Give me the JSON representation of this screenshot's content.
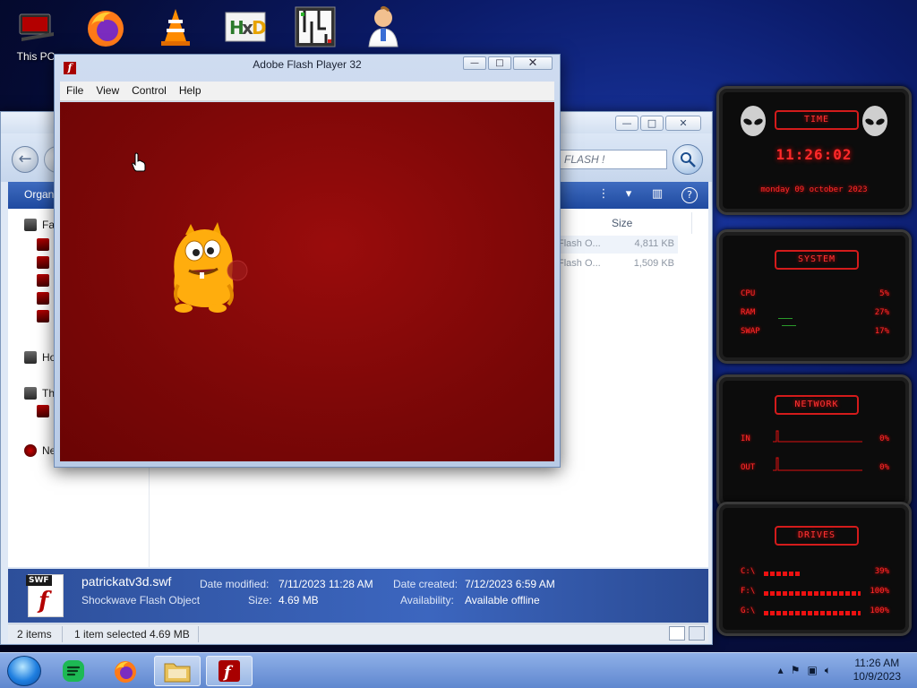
{
  "desktop": {
    "icons": [
      {
        "label": "This PC"
      },
      {
        "label": ""
      },
      {
        "label": ""
      },
      {
        "label": ""
      },
      {
        "label": ""
      },
      {
        "label": ""
      }
    ]
  },
  "flash_window": {
    "title": "Adobe Flash Player 32",
    "menu": [
      "File",
      "View",
      "Control",
      "Help"
    ],
    "buttons": {
      "minimize": "—",
      "maximize": "□",
      "close": "✕"
    }
  },
  "explorer": {
    "toolbar": {
      "organize": "Organi"
    },
    "search_text": "FLASH !",
    "columns": {
      "size": "Size"
    },
    "files": [
      {
        "type": "Flash O...",
        "size": "4,811 KB"
      },
      {
        "type": "Flash O...",
        "size": "1,509 KB"
      }
    ],
    "nav_items": [
      "Fa",
      "Ho",
      "Th",
      "Ne"
    ],
    "details": {
      "filename": "patrickatv3d.swf",
      "filetype": "Shockwave Flash Object",
      "date_modified_label": "Date modified:",
      "date_modified": "7/11/2023 11:28 AM",
      "size_label": "Size:",
      "size": "4.69 MB",
      "date_created_label": "Date created:",
      "date_created": "7/12/2023 6:59 AM",
      "availability_label": "Availability:",
      "availability": "Available offline",
      "icon_tag": "SWF",
      "icon_letter": "f"
    },
    "status": {
      "items": "2 items",
      "selected": "1 item selected  4.69 MB"
    }
  },
  "gadgets": {
    "time": {
      "title": "TIME",
      "clock": "11:26:02",
      "date": "monday 09 october 2023"
    },
    "system": {
      "title": "SYSTEM",
      "rows": [
        {
          "label": "CPU",
          "value": "5%"
        },
        {
          "label": "RAM",
          "value": "27%"
        },
        {
          "label": "SWAP",
          "value": "17%"
        }
      ]
    },
    "network": {
      "title": "NETWORK",
      "rows": [
        {
          "label": "IN",
          "value": "0%"
        },
        {
          "label": "OUT",
          "value": "0%"
        }
      ]
    },
    "drives": {
      "title": "DRIVES",
      "rows": [
        {
          "label": "C:\\",
          "value": "39%",
          "fill": 0.39
        },
        {
          "label": "F:\\",
          "value": "100%",
          "fill": 1.0
        },
        {
          "label": "G:\\",
          "value": "100%",
          "fill": 1.0
        }
      ]
    }
  },
  "taskbar": {
    "time": "11:26 AM",
    "date": "10/9/2023"
  },
  "colors": {
    "flash_stage": "#7a0707",
    "gadget_red": "#ff2a2a",
    "explorer_band": "#2d4f9a"
  }
}
